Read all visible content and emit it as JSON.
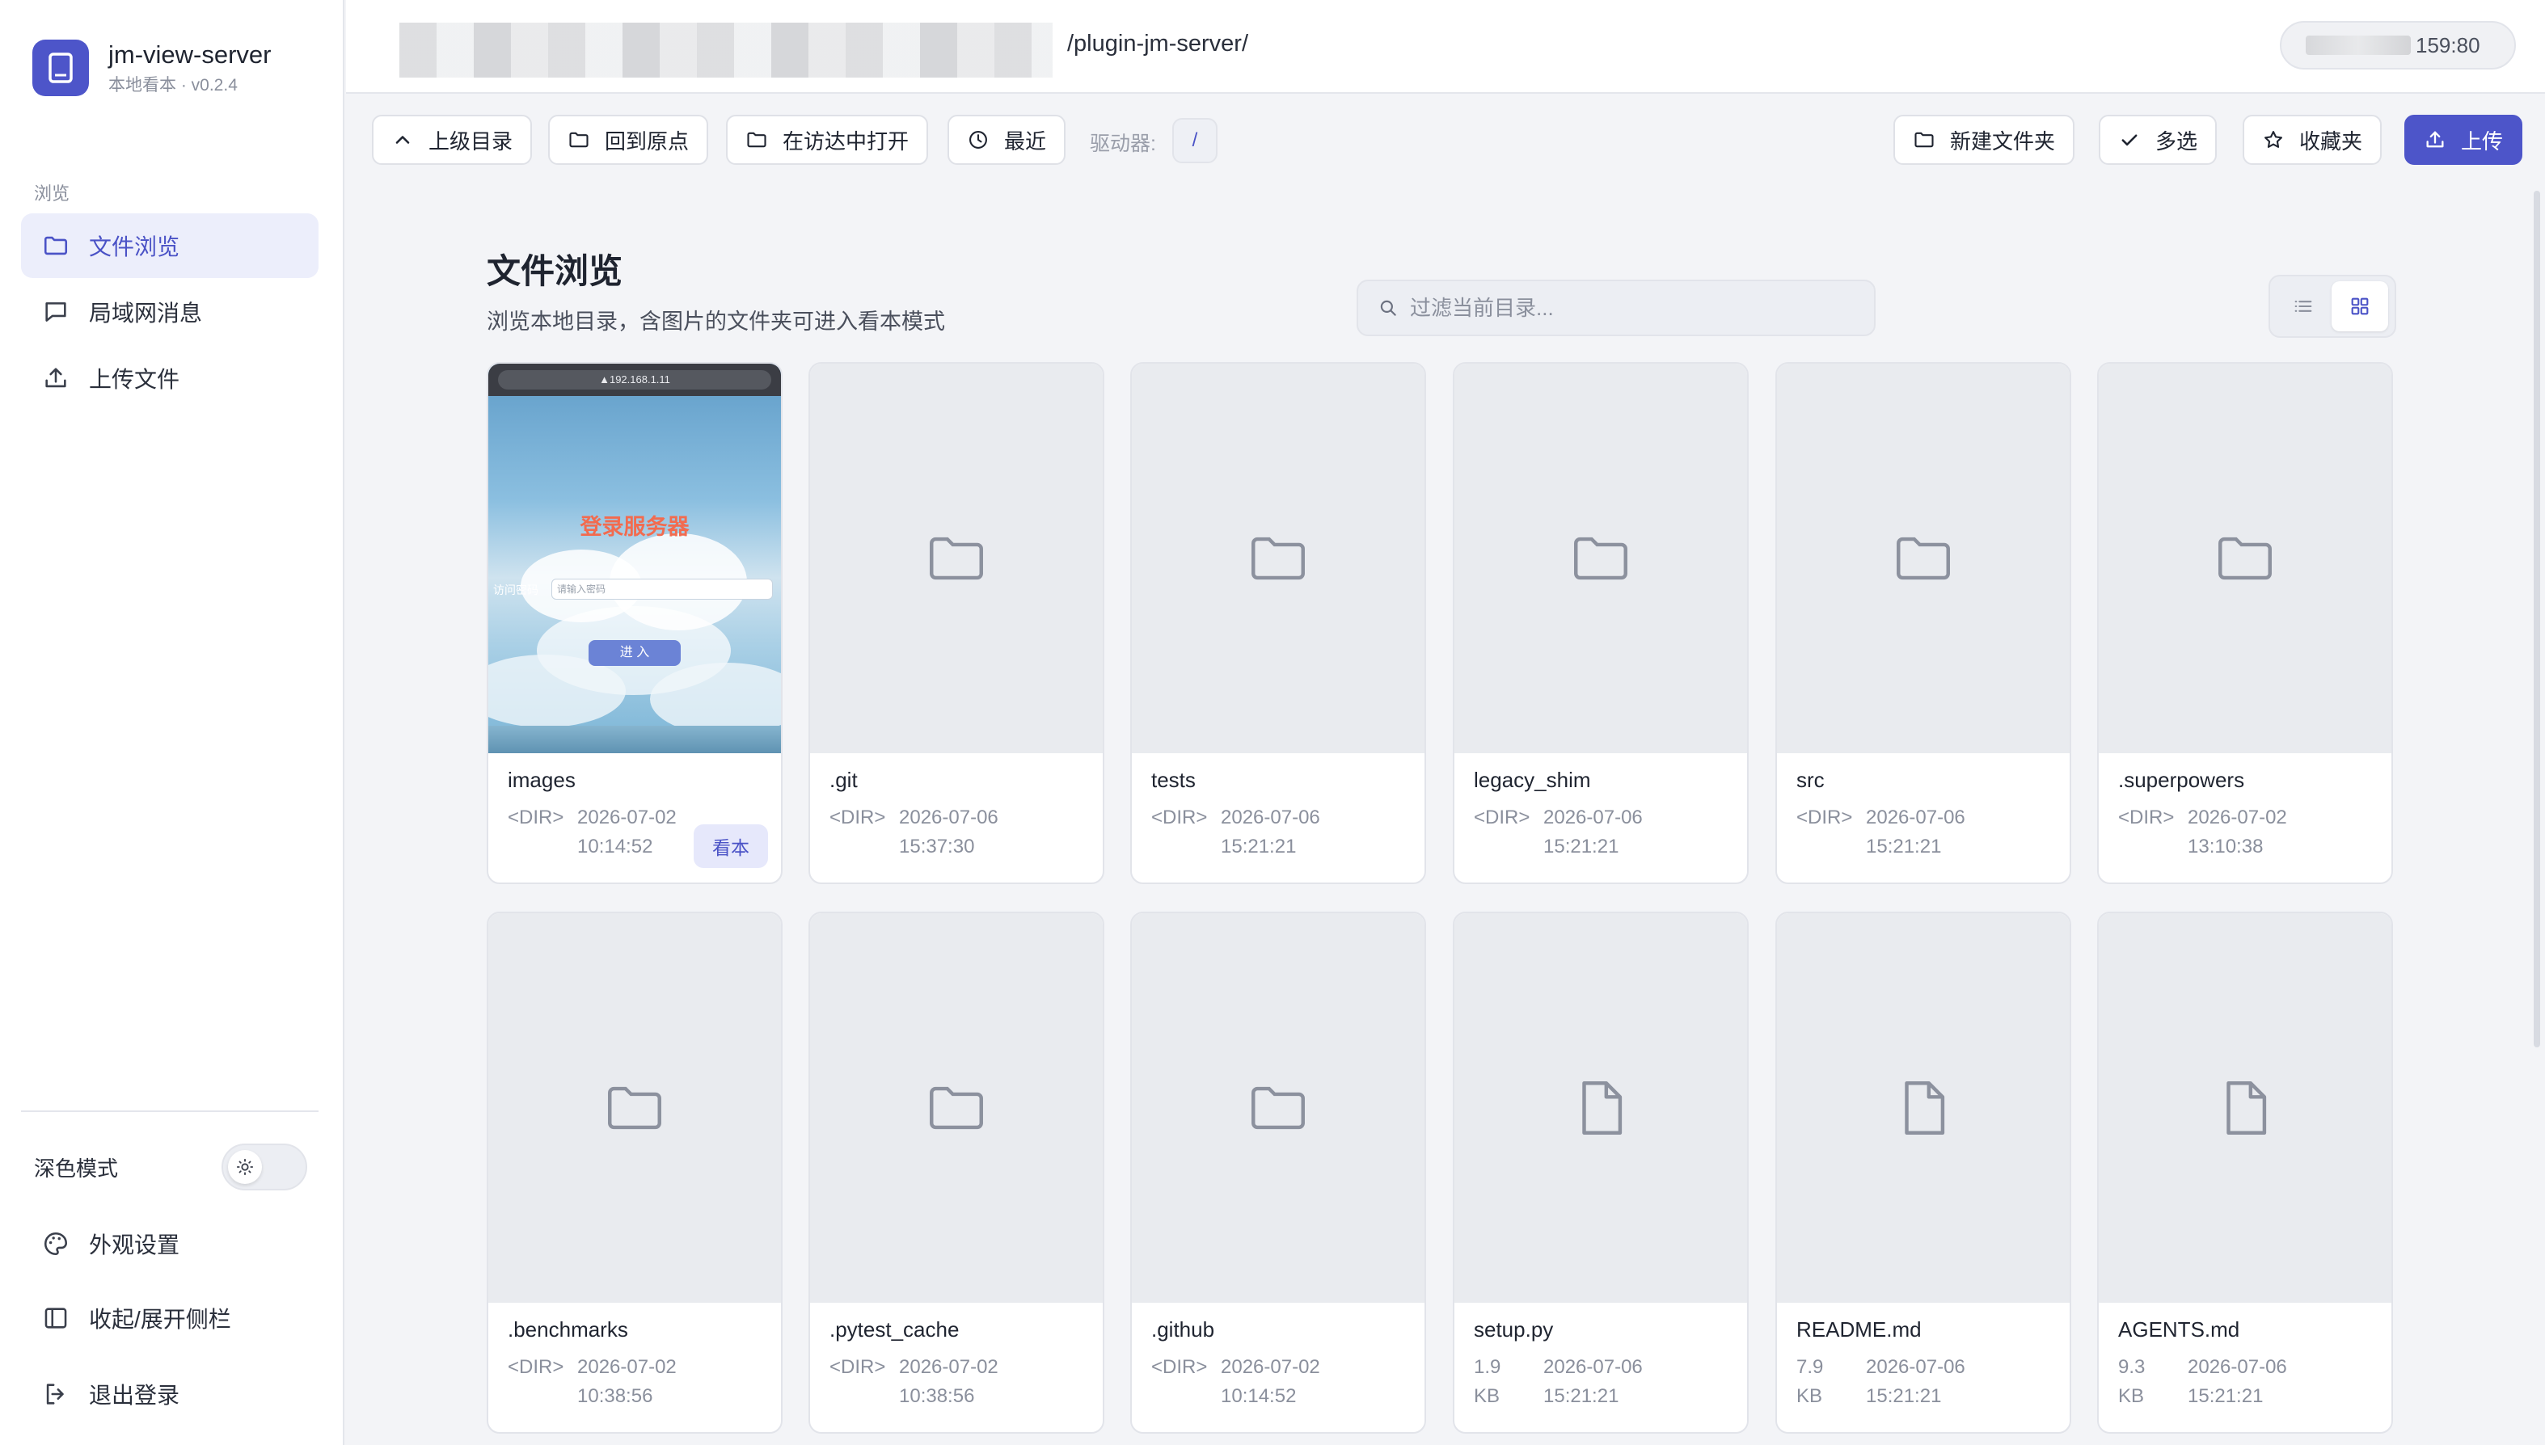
{
  "brand": {
    "name": "jm-view-server",
    "subtitle": "本地看本 · v0.2.4"
  },
  "sidebar": {
    "section_label": "浏览",
    "items": [
      {
        "label": "文件浏览",
        "icon": "folder-icon",
        "active": true
      },
      {
        "label": "局域网消息",
        "icon": "chat-icon",
        "active": false
      },
      {
        "label": "上传文件",
        "icon": "upload-icon",
        "active": false
      }
    ],
    "dark_mode_label": "深色模式",
    "dark_mode_on": false,
    "bottom_items": [
      {
        "label": "外观设置",
        "icon": "palette-icon"
      },
      {
        "label": "收起/展开侧栏",
        "icon": "sidebar-toggle-icon"
      },
      {
        "label": "退出登录",
        "icon": "logout-icon"
      }
    ]
  },
  "topbar": {
    "path_suffix": "/plugin-jm-server/",
    "server_port": "159:80"
  },
  "toolbar": {
    "up_label": "上级目录",
    "home_label": "回到原点",
    "open_finder_label": "在访达中打开",
    "recent_label": "最近",
    "drive_label": "驱动器:",
    "drive_value": "/",
    "new_folder_label": "新建文件夹",
    "multiselect_label": "多选",
    "favorites_label": "收藏夹",
    "upload_label": "上传"
  },
  "main": {
    "title": "文件浏览",
    "subtitle": "浏览本地目录，含图片的文件夹可进入看本模式",
    "filter_placeholder": "过滤当前目录..."
  },
  "preview": {
    "url": "▲192.168.1.11",
    "title": "登录服务器",
    "label": "访问密码",
    "input_placeholder": "请输入密码",
    "button": "进  入"
  },
  "files": [
    {
      "name": "images",
      "kind": "<DIR>",
      "date": "2026-07-02",
      "time": "10:14:52",
      "type": "image-dir",
      "action": "看本"
    },
    {
      "name": ".git",
      "kind": "<DIR>",
      "date": "2026-07-06",
      "time": "15:37:30",
      "type": "dir"
    },
    {
      "name": "tests",
      "kind": "<DIR>",
      "date": "2026-07-06",
      "time": "15:21:21",
      "type": "dir"
    },
    {
      "name": "legacy_shim",
      "kind": "<DIR>",
      "date": "2026-07-06",
      "time": "15:21:21",
      "type": "dir"
    },
    {
      "name": "src",
      "kind": "<DIR>",
      "date": "2026-07-06",
      "time": "15:21:21",
      "type": "dir"
    },
    {
      "name": ".superpowers",
      "kind": "<DIR>",
      "date": "2026-07-02",
      "time": "13:10:38",
      "type": "dir"
    },
    {
      "name": ".benchmarks",
      "kind": "<DIR>",
      "date": "2026-07-02",
      "time": "10:38:56",
      "type": "dir"
    },
    {
      "name": ".pytest_cache",
      "kind": "<DIR>",
      "date": "2026-07-02",
      "time": "10:38:56",
      "type": "dir"
    },
    {
      "name": ".github",
      "kind": "<DIR>",
      "date": "2026-07-02",
      "time": "10:14:52",
      "type": "dir"
    },
    {
      "name": "setup.py",
      "kind": "1.9",
      "kind_unit": "KB",
      "date": "2026-07-06",
      "time": "15:21:21",
      "type": "file"
    },
    {
      "name": "README.md",
      "kind": "7.9",
      "kind_unit": "KB",
      "date": "2026-07-06",
      "time": "15:21:21",
      "type": "file"
    },
    {
      "name": "AGENTS.md",
      "kind": "9.3",
      "kind_unit": "KB",
      "date": "2026-07-06",
      "time": "15:21:21",
      "type": "file"
    }
  ],
  "colors": {
    "accent": "#4d55c9",
    "active_bg": "#eceefb",
    "card_thumb": "#e9ebef",
    "muted_text": "#8a8f9c"
  }
}
